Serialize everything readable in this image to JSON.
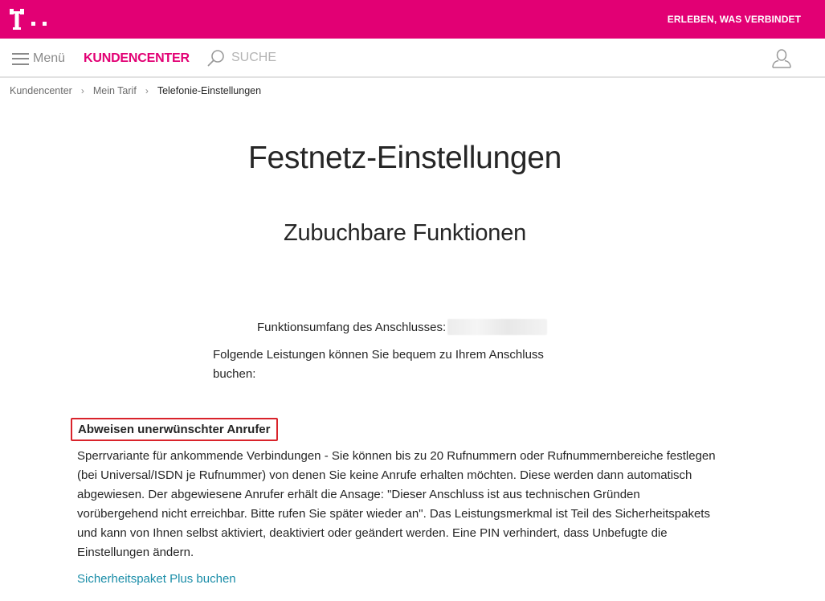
{
  "header": {
    "slogan": "ERLEBEN, WAS VERBINDET",
    "brand_color": "#e20074"
  },
  "nav": {
    "menu_label": "Menü",
    "kundencenter_label": "KUNDENCENTER",
    "search_label": "SUCHE"
  },
  "breadcrumb": {
    "items": [
      "Kundencenter",
      "Mein Tarif"
    ],
    "current": "Telefonie-Einstellungen"
  },
  "page": {
    "title": "Festnetz-Einstellungen",
    "subtitle": "Zubuchbare Funktionen",
    "scope_label": "Funktionsumfang des Anschlusses:",
    "intro_text": "Folgende Leistungen können Sie bequem zu Ihrem Anschluss buchen:"
  },
  "feature": {
    "title": "Abweisen unerwünschter Anrufer",
    "description": "Sperrvariante für ankommende Verbindungen - Sie können bis zu 20 Rufnummern oder Rufnummernbereiche festlegen (bei Universal/ISDN je Rufnummer) von denen Sie keine Anrufe erhalten möchten. Diese werden dann automatisch abgewiesen. Der abgewiesene Anrufer erhält die Ansage: \"Dieser Anschluss ist aus technischen Gründen vorübergehend nicht erreichbar. Bitte rufen Sie später wieder an\". Das Leistungsmerkmal ist Teil des Sicherheitspakets und kann von Ihnen selbst aktiviert, deaktiviert oder geändert werden. Eine PIN verhindert, dass Unbefugte die Einstellungen ändern.",
    "link_label": "Sicherheitspaket Plus buchen",
    "link_color": "#1a8da8",
    "highlight_color": "#d9232b"
  }
}
